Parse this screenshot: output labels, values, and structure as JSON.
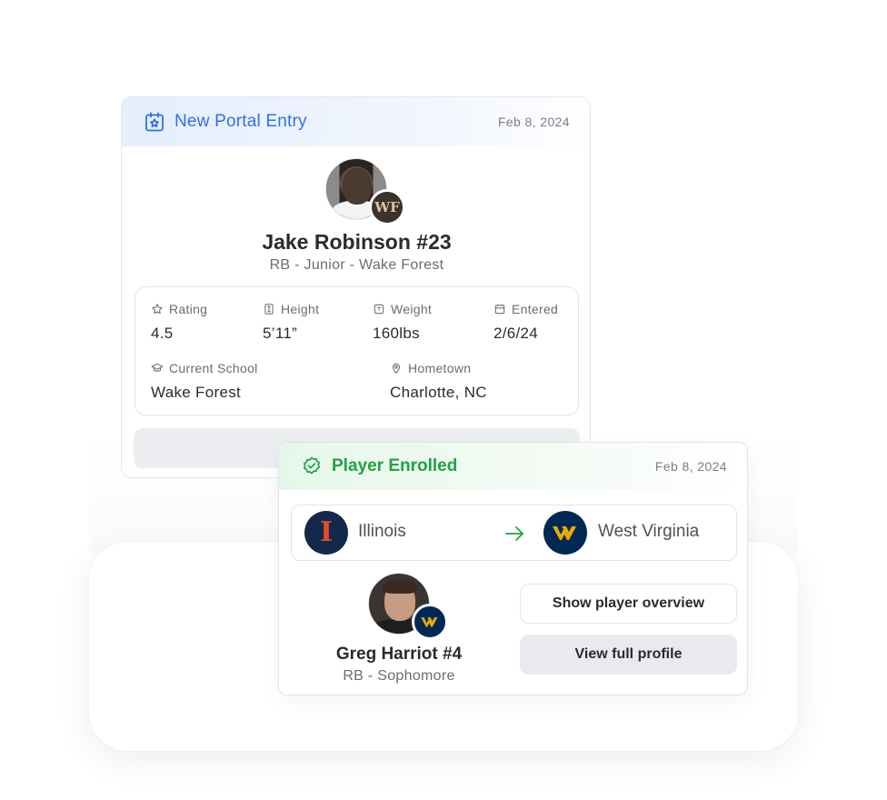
{
  "portal_card": {
    "title": "New Portal Entry",
    "date": "Feb 8, 2024",
    "player": {
      "name": "Jake Robinson #23",
      "subtitle": "RB - Junior - Wake Forest",
      "school_badge_text": "WF"
    },
    "stats": {
      "rating": {
        "label": "Rating",
        "value": "4.5",
        "icon": "star-icon"
      },
      "height": {
        "label": "Height",
        "value": "5’11”",
        "icon": "ruler-icon"
      },
      "weight": {
        "label": "Weight",
        "value": "160lbs",
        "icon": "scale-icon"
      },
      "entered": {
        "label": "Entered",
        "value": "2/6/24",
        "icon": "calendar-icon"
      },
      "current_school": {
        "label": "Current School",
        "value": "Wake Forest",
        "icon": "graduation-cap-icon"
      },
      "hometown": {
        "label": "Hometown",
        "value": "Charlotte, NC",
        "icon": "location-pin-icon"
      }
    }
  },
  "enrolled_card": {
    "title": "Player Enrolled",
    "date": "Feb 8, 2024",
    "from_school": {
      "name": "Illinois",
      "logo_text": "I",
      "color": "#e84a27",
      "bg": "#13294b"
    },
    "to_school": {
      "name": "West Virginia",
      "color": "#eaaa00",
      "bg": "#002855"
    },
    "player": {
      "name": "Greg Harriot #4",
      "subtitle": "RB - Sophomore"
    },
    "buttons": {
      "overview": "Show player overview",
      "profile": "View full profile"
    }
  },
  "colors": {
    "portal_accent": "#2f6ff0",
    "enrolled_accent": "#1fa343"
  }
}
